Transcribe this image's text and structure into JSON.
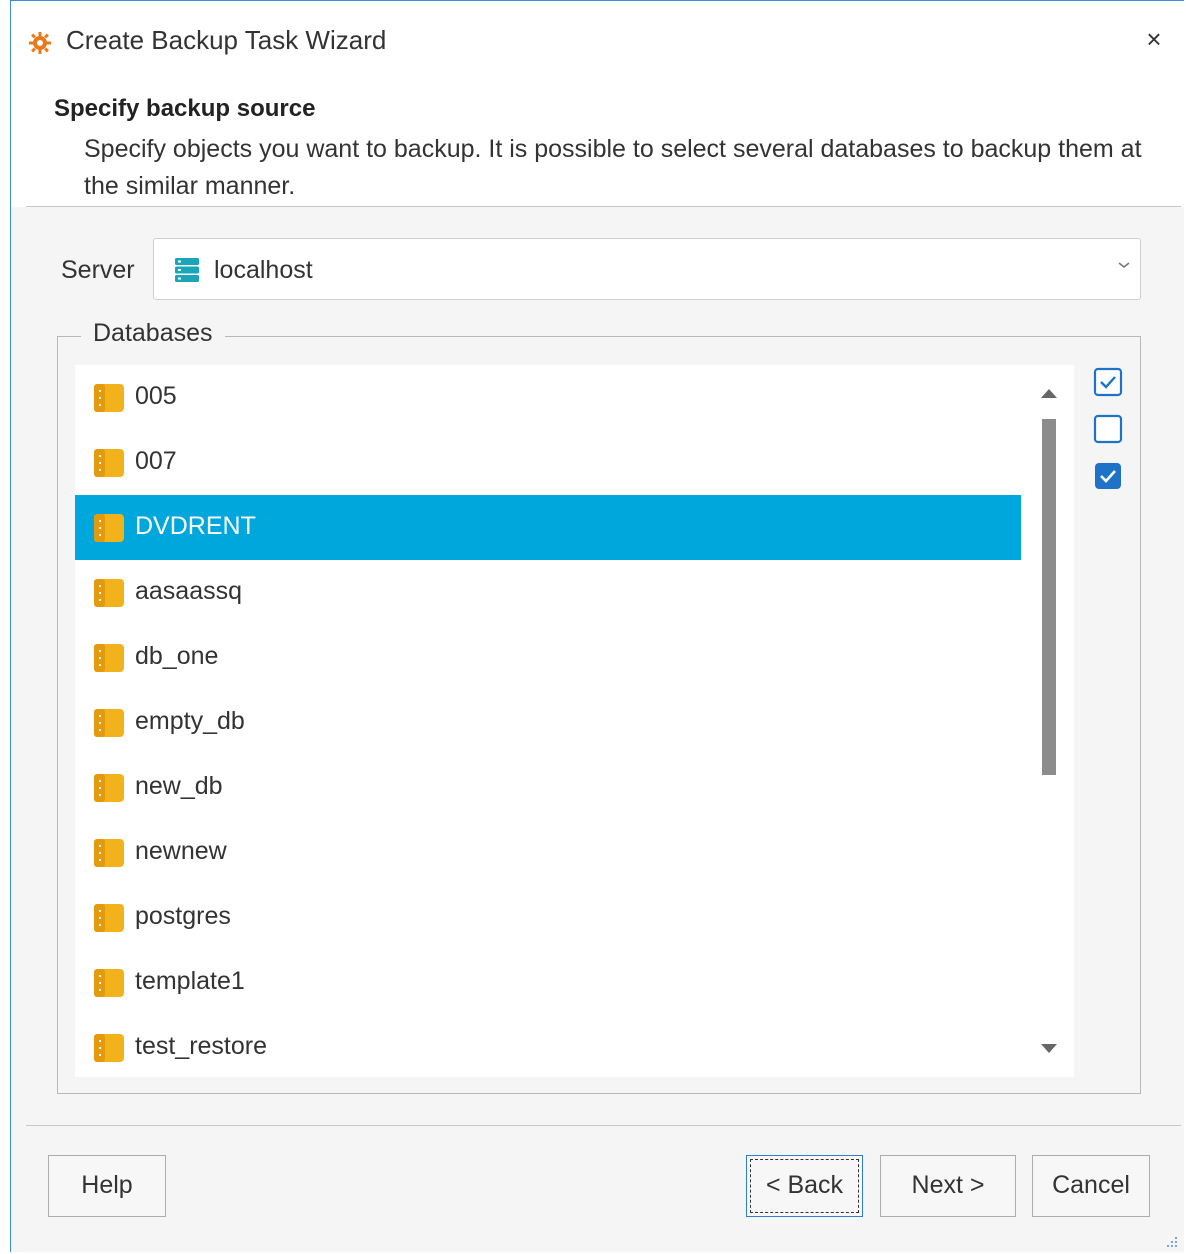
{
  "window": {
    "title": "Create Backup Task Wizard",
    "close_glyph": "×",
    "app_icon": "gear-icon",
    "accent_color": "#e97a1c"
  },
  "header": {
    "title": "Specify backup source",
    "description": "Specify objects you want to backup. It is possible to select several databases to backup them at the similar manner."
  },
  "server": {
    "label": "Server",
    "value": "localhost",
    "icon": "server-icon"
  },
  "databases": {
    "legend": "Databases",
    "selected_color": "#00a7dc",
    "items": [
      {
        "name": "005",
        "selected": false
      },
      {
        "name": "007",
        "selected": false
      },
      {
        "name": "DVDRENT",
        "selected": true
      },
      {
        "name": "aasaassq",
        "selected": false
      },
      {
        "name": "db_one",
        "selected": false
      },
      {
        "name": "empty_db",
        "selected": false
      },
      {
        "name": "new_db",
        "selected": false
      },
      {
        "name": "newnew",
        "selected": false
      },
      {
        "name": "postgres",
        "selected": false
      },
      {
        "name": "template1",
        "selected": false
      },
      {
        "name": "test_restore",
        "selected": false
      }
    ]
  },
  "side_buttons": [
    "check-all-icon",
    "uncheck-all-icon",
    "check-selected-icon"
  ],
  "buttons": {
    "help": "Help",
    "back": "< Back",
    "next": "Next >",
    "cancel": "Cancel"
  }
}
